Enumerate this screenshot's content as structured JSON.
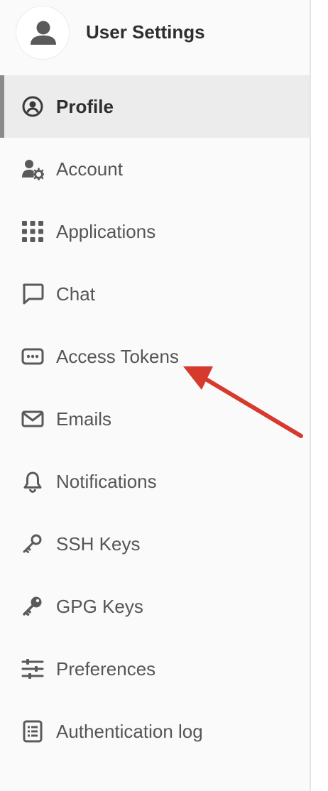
{
  "header": {
    "title": "User Settings"
  },
  "nav": {
    "items": [
      {
        "label": "Profile",
        "icon": "profile-icon",
        "active": true
      },
      {
        "label": "Account",
        "icon": "account-settings-icon"
      },
      {
        "label": "Applications",
        "icon": "applications-grid-icon"
      },
      {
        "label": "Chat",
        "icon": "chat-icon"
      },
      {
        "label": "Access Tokens",
        "icon": "access-token-icon"
      },
      {
        "label": "Emails",
        "icon": "envelope-icon"
      },
      {
        "label": "Notifications",
        "icon": "bell-icon"
      },
      {
        "label": "SSH Keys",
        "icon": "key-icon"
      },
      {
        "label": "GPG Keys",
        "icon": "key-solid-icon"
      },
      {
        "label": "Preferences",
        "icon": "sliders-icon"
      },
      {
        "label": "Authentication log",
        "icon": "log-icon"
      }
    ]
  },
  "colors": {
    "arrow": "#d63a2c",
    "active_bar": "#8a8a8a",
    "icon": "#5a5a5a"
  }
}
